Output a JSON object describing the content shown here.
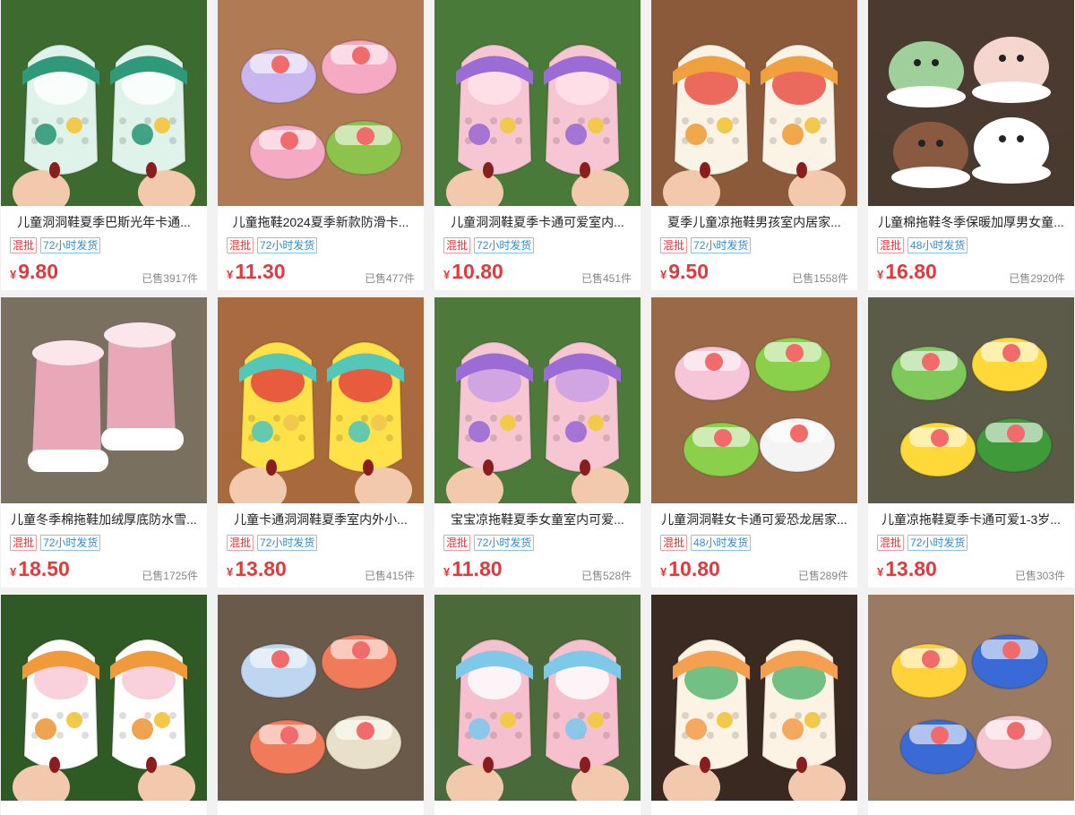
{
  "products": [
    {
      "title": "儿童洞洞鞋夏季巴斯光年卡通...",
      "tag1": "混批",
      "tag2": "72小时发货",
      "currency": "¥",
      "price": "9.80",
      "sold": "已售3917件",
      "scene": "crocs",
      "bg": "#3d6a2f",
      "c1": "#dff3ea",
      "c2": "#2f9a7a",
      "c3": "#ffffff"
    },
    {
      "title": "儿童拖鞋2024夏季新款防滑卡...",
      "tag1": "混批",
      "tag2": "72小时发货",
      "currency": "¥",
      "price": "11.30",
      "sold": "已售477件",
      "scene": "slides",
      "bg": "#b07a55",
      "c1": "#c9b6f0",
      "c2": "#f6a9c3",
      "c3": "#8cc34b"
    },
    {
      "title": "儿童洞洞鞋夏季卡通可爱室内...",
      "tag1": "混批",
      "tag2": "72小时发货",
      "currency": "¥",
      "price": "10.80",
      "sold": "已售451件",
      "scene": "crocs",
      "bg": "#4a7a3a",
      "c1": "#f7c6d3",
      "c2": "#9b6bd6",
      "c3": "#ffe4ec"
    },
    {
      "title": "夏季儿童凉拖鞋男孩室内居家...",
      "tag1": "混批",
      "tag2": "72小时发货",
      "currency": "¥",
      "price": "9.50",
      "sold": "已售1558件",
      "scene": "crocs",
      "bg": "#8a5a3a",
      "c1": "#fbf3e6",
      "c2": "#f0a03c",
      "c3": "#e9463c"
    },
    {
      "title": "儿童棉拖鞋冬季保暖加厚男女童...",
      "tag1": "混批",
      "tag2": "48小时发货",
      "currency": "¥",
      "price": "16.80",
      "sold": "已售2920件",
      "scene": "fluffy",
      "bg": "#4a3a30",
      "c1": "#f4d6cf",
      "c2": "#9fcf9a",
      "c3": "#222222"
    },
    {
      "title": "儿童冬季棉拖鞋加绒厚底防水雪...",
      "tag1": "混批",
      "tag2": "72小时发货",
      "currency": "¥",
      "price": "18.50",
      "sold": "已售1725件",
      "scene": "boot",
      "bg": "#7a7060",
      "c1": "#e9a8b8",
      "c2": "#fbe6ec",
      "c3": "#ffffff"
    },
    {
      "title": "儿童卡通洞洞鞋夏季室内外小...",
      "tag1": "混批",
      "tag2": "72小时发货",
      "currency": "¥",
      "price": "13.80",
      "sold": "已售415件",
      "scene": "crocs",
      "bg": "#a86a3e",
      "c1": "#ffe14a",
      "c2": "#54c7b8",
      "c3": "#e33a3a"
    },
    {
      "title": "宝宝凉拖鞋夏季女童室内可爱...",
      "tag1": "混批",
      "tag2": "72小时发货",
      "currency": "¥",
      "price": "11.80",
      "sold": "已售528件",
      "scene": "crocs",
      "bg": "#4d7a3a",
      "c1": "#f7c6d3",
      "c2": "#9b6bd6",
      "c3": "#c79be6"
    },
    {
      "title": "儿童洞洞鞋女卡通可爱恐龙居家...",
      "tag1": "混批",
      "tag2": "48小时发货",
      "currency": "¥",
      "price": "10.80",
      "sold": "已售289件",
      "scene": "slides",
      "bg": "#9a6a48",
      "c1": "#f6c6d8",
      "c2": "#8bd04a",
      "c3": "#f4f4f4"
    },
    {
      "title": "儿童凉拖鞋夏季卡通可爱1-3岁...",
      "tag1": "混批",
      "tag2": "72小时发货",
      "currency": "¥",
      "price": "13.80",
      "sold": "已售303件",
      "scene": "slides",
      "bg": "#5c5a48",
      "c1": "#7fc95a",
      "c2": "#ffd93a",
      "c3": "#3f9a3a"
    },
    {
      "title": "",
      "tag1": "",
      "tag2": "",
      "currency": "",
      "price": "",
      "sold": "",
      "scene": "crocs",
      "bg": "#2f5a25",
      "c1": "#ffffff",
      "c2": "#f09a3c",
      "c3": "#f7c6d3"
    },
    {
      "title": "",
      "tag1": "",
      "tag2": "",
      "currency": "",
      "price": "",
      "sold": "",
      "scene": "slides",
      "bg": "#6a5a4a",
      "c1": "#bfd6f0",
      "c2": "#f07a5a",
      "c3": "#e8e0c8"
    },
    {
      "title": "",
      "tag1": "",
      "tag2": "",
      "currency": "",
      "price": "",
      "sold": "",
      "scene": "crocs",
      "bg": "#4a6a3a",
      "c1": "#f7c0cf",
      "c2": "#7ec8ea",
      "c3": "#ffffff"
    },
    {
      "title": "",
      "tag1": "",
      "tag2": "",
      "currency": "",
      "price": "",
      "sold": "",
      "scene": "crocs",
      "bg": "#3a2a22",
      "c1": "#fdf3e4",
      "c2": "#f4a050",
      "c3": "#4fb36a"
    },
    {
      "title": "",
      "tag1": "",
      "tag2": "",
      "currency": "",
      "price": "",
      "sold": "",
      "scene": "slides",
      "bg": "#9a7a60",
      "c1": "#ffd23a",
      "c2": "#3a6ad6",
      "c3": "#f7c6d3"
    }
  ]
}
